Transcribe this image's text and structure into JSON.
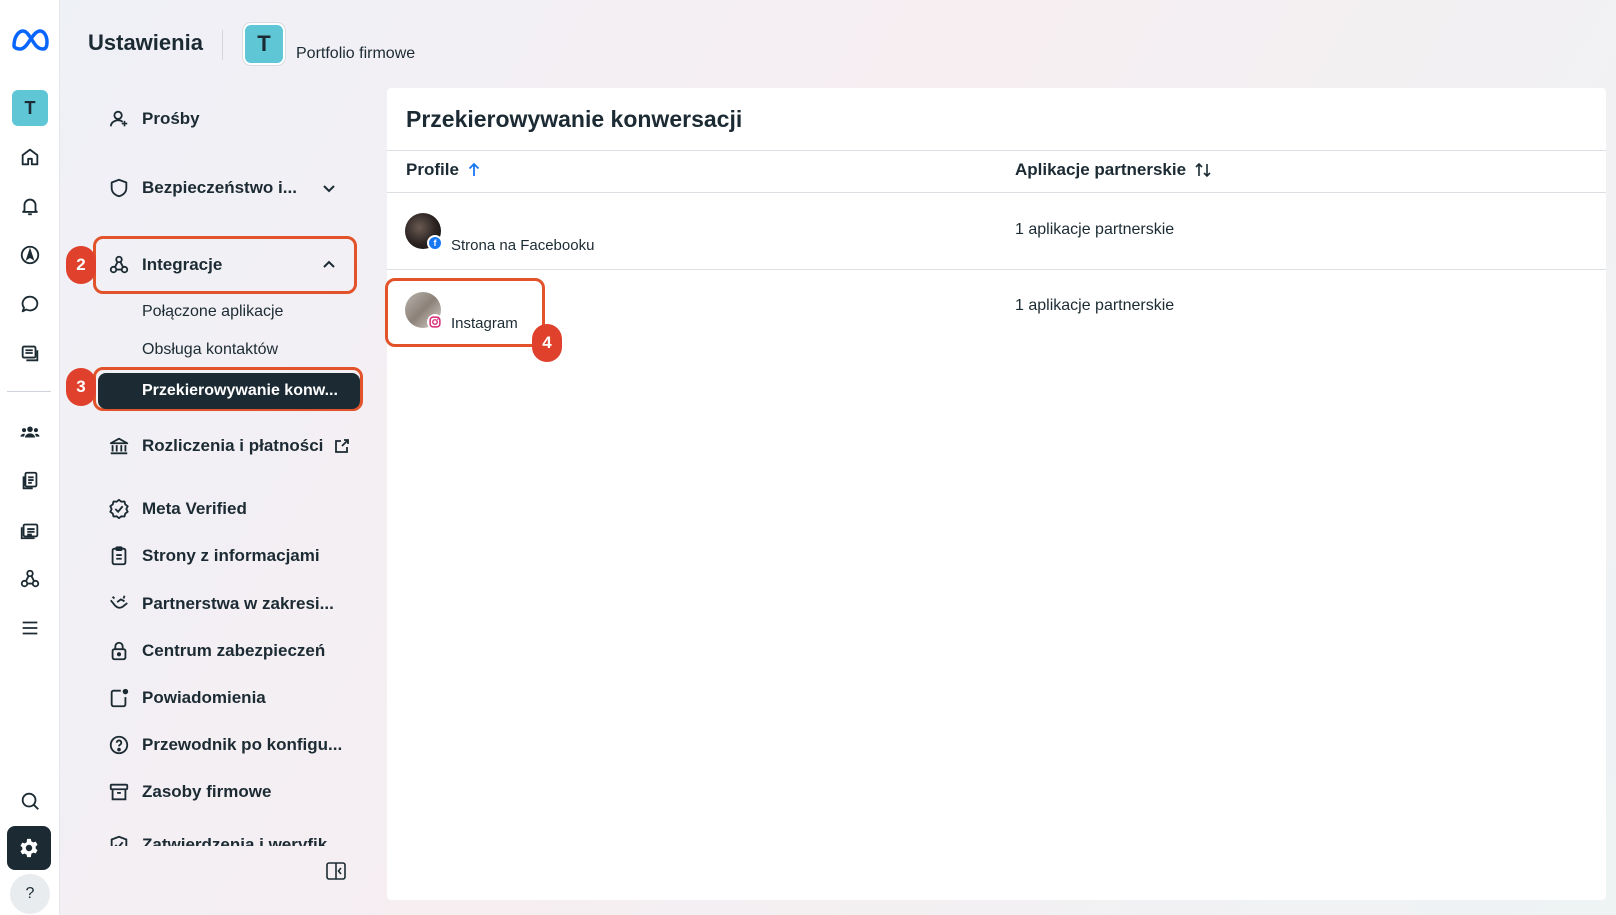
{
  "rail": {
    "logo_icon": "meta-logo-icon",
    "avatar_letter": "T",
    "items": [
      "home-icon",
      "bell-icon",
      "compass-icon",
      "chat-icon",
      "inbox-icon",
      "people-icon",
      "documents-icon",
      "ads-icon",
      "integrations-icon",
      "menu-icon",
      "search-icon"
    ],
    "settings_icon": "gear-icon",
    "help_label": "?"
  },
  "header": {
    "title": "Ustawienia",
    "avatar_letter": "T",
    "portfolio": "Portfolio firmowe"
  },
  "sidebar": {
    "items": [
      {
        "label": "Prośby",
        "icon": "person-icon"
      },
      {
        "label": "Bezpieczeństwo i...",
        "icon": "shield-icon"
      },
      {
        "label": "Integracje",
        "icon": "integrations-icon"
      },
      {
        "label": "Rozliczenia i płatności",
        "icon": "bank-icon"
      },
      {
        "label": "Meta Verified",
        "icon": "verified-badge-icon"
      },
      {
        "label": "Strony z informacjami",
        "icon": "clipboard-icon"
      },
      {
        "label": "Partnerstwa w zakresi...",
        "icon": "handshake-icon"
      },
      {
        "label": "Centrum zabezpieczeń",
        "icon": "lock-icon"
      },
      {
        "label": "Powiadomienia",
        "icon": "notification-icon"
      },
      {
        "label": "Przewodnik po konfigu...",
        "icon": "question-circle-icon"
      },
      {
        "label": "Zasoby firmowe",
        "icon": "archive-icon"
      },
      {
        "label": "Zatwierdzenia i weryfik...",
        "icon": "check-shield-icon"
      }
    ],
    "subitems": [
      "Połączone aplikacje",
      "Obsługa kontaktów",
      "Przekierowywanie konw..."
    ],
    "steps": [
      "2",
      "3",
      "4"
    ]
  },
  "main": {
    "title": "Przekierowywanie konwersacji",
    "columns": [
      "Profile",
      "Aplikacje partnerskie"
    ],
    "rows": [
      {
        "profile": "Strona na Facebooku",
        "platform": "facebook-icon",
        "apps": "1 aplikacje partnerskie"
      },
      {
        "profile": "Instagram",
        "platform": "instagram-icon",
        "apps": "1 aplikacje partnerskie"
      }
    ]
  },
  "colors": {
    "accent_dark": "#1c2b33",
    "highlight": "#e2532b",
    "badge": "#e0412c",
    "avatar": "#5fc6d6",
    "link_blue": "#1877f2"
  }
}
